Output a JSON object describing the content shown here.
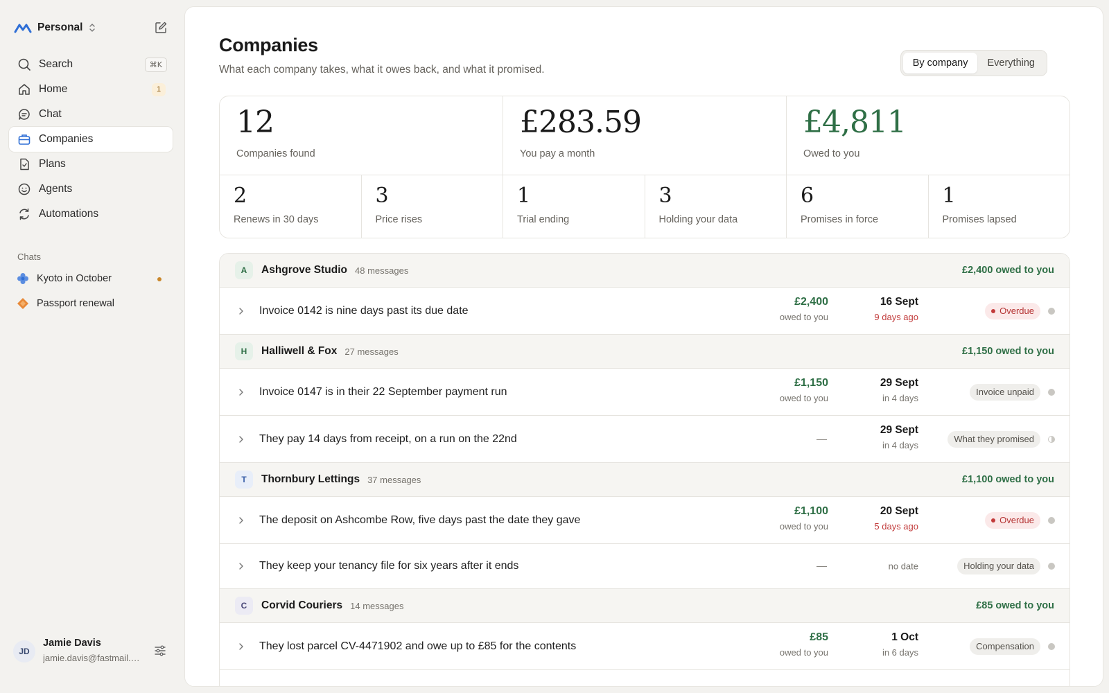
{
  "workspace": {
    "name": "Personal"
  },
  "nav": {
    "items": [
      {
        "label": "Search",
        "icon": "search-icon",
        "shortcut": "⌘K"
      },
      {
        "label": "Home",
        "icon": "home-icon",
        "count": "1"
      },
      {
        "label": "Chat",
        "icon": "chat-bubble-icon"
      },
      {
        "label": "Companies",
        "icon": "briefcase-icon",
        "active": true
      },
      {
        "label": "Plans",
        "icon": "document-icon"
      },
      {
        "label": "Agents",
        "icon": "smiley-icon"
      },
      {
        "label": "Automations",
        "icon": "refresh-icon"
      }
    ]
  },
  "chats": {
    "heading": "Chats",
    "items": [
      {
        "label": "Kyoto in October",
        "icon": "blue-flower-icon",
        "unread": true
      },
      {
        "label": "Passport renewal",
        "icon": "orange-diamond-icon"
      }
    ]
  },
  "user": {
    "initials": "JD",
    "name": "Jamie Davis",
    "email": "jamie.davis@fastmail.com"
  },
  "page": {
    "title": "Companies",
    "subtitle": "What each company takes, what it owes back, and what it promised."
  },
  "view_toggle": {
    "by_company": "By company",
    "everything": "Everything",
    "selected": "By company"
  },
  "stats": {
    "big": [
      {
        "value": "12",
        "label": "Companies found"
      },
      {
        "value": "£283.59",
        "label": "You pay a month"
      },
      {
        "value": "£4,811",
        "label": "Owed to you",
        "accent": "#2f6f46"
      }
    ],
    "small": [
      {
        "value": "2",
        "label": "Renews in 30 days"
      },
      {
        "value": "3",
        "label": "Price rises"
      },
      {
        "value": "1",
        "label": "Trial ending"
      },
      {
        "value": "3",
        "label": "Holding your data"
      },
      {
        "value": "6",
        "label": "Promises in force"
      },
      {
        "value": "1",
        "label": "Promises lapsed"
      }
    ]
  },
  "groups": [
    {
      "initial": "A",
      "name": "Ashgrove Studio",
      "messages": "48 messages",
      "owed": "£2,400 owed to you",
      "rows": [
        {
          "text": "Invoice 0142 is nine days past its due date",
          "amount": "£2,400",
          "amount_label": "owed to you",
          "date": "16 Sept",
          "date_note": "9 days ago",
          "status": "Overdue"
        }
      ]
    },
    {
      "initial": "H",
      "name": "Halliwell & Fox",
      "messages": "27 messages",
      "owed": "£1,150 owed to you",
      "rows": [
        {
          "text": "Invoice 0147 is in their 22 September payment run",
          "amount": "£1,150",
          "amount_label": "owed to you",
          "date": "29 Sept",
          "date_note": "in 4 days",
          "status": "Invoice unpaid"
        },
        {
          "text": "They pay 14 days from receipt, on a run on the 22nd",
          "amount": "—",
          "date": "29 Sept",
          "date_note": "in 4 days",
          "status": "What they promised"
        }
      ]
    },
    {
      "initial": "T",
      "name": "Thornbury Lettings",
      "messages": "37 messages",
      "owed": "£1,100 owed to you",
      "rows": [
        {
          "text": "The deposit on Ashcombe Row, five days past the date they gave",
          "amount": "£1,100",
          "amount_label": "owed to you",
          "date": "20 Sept",
          "date_note": "5 days ago",
          "status": "Overdue"
        },
        {
          "text": "They keep your tenancy file for six years after it ends",
          "amount": "—",
          "date": "no date",
          "status": "Holding your data"
        }
      ]
    },
    {
      "initial": "C",
      "name": "Corvid Couriers",
      "messages": "14 messages",
      "owed": "£85 owed to you",
      "rows": [
        {
          "text": "They lost parcel CV-4471902 and owe up to £85 for the contents",
          "amount": "£85",
          "amount_label": "owed to you",
          "date": "1 Oct",
          "date_note": "in 6 days",
          "status": "Compensation"
        }
      ]
    }
  ],
  "colors": {
    "accent_green": "#2f6f46",
    "overdue_red": "#c23b3b",
    "brand_blue": "#2f6fd6"
  }
}
